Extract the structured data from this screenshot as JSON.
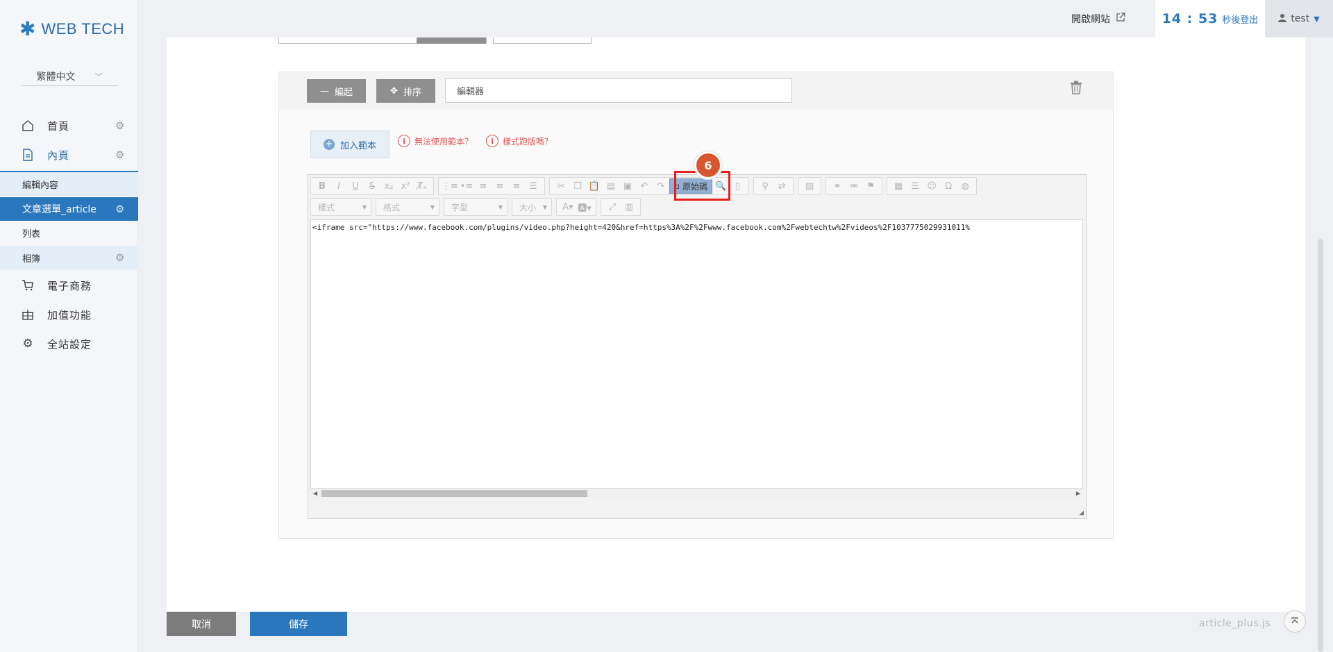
{
  "brand": {
    "logo_text": "WEB TECH"
  },
  "sidebar": {
    "language": "繁體中文",
    "items": [
      {
        "label": "首頁"
      },
      {
        "label": "內頁"
      },
      {
        "label": "電子商務"
      },
      {
        "label": "加值功能"
      },
      {
        "label": "全站設定"
      }
    ],
    "subitems": [
      {
        "label": "編輯內容"
      },
      {
        "label": "文章選單_article"
      },
      {
        "label": "列表"
      },
      {
        "label": "相簿"
      }
    ]
  },
  "topbar": {
    "open_site": "開啟網站",
    "countdown": "14 : 53",
    "countdown_suffix": "秒後登出",
    "user": "test"
  },
  "block": {
    "collapse_label": "編起",
    "sort_label": "排序",
    "title_value": "編輯器",
    "add_template": "加入範本",
    "warn1": "無法使用範本？",
    "warn2": "樣式跑版嗎？"
  },
  "editor": {
    "combos": [
      "樣式",
      "格式",
      "字型",
      "大小"
    ],
    "source_label": "原始碼",
    "code": "<iframe src=\"https://www.facebook.com/plugins/video.php?height=420&href=https%3A%2F%2Fwww.facebook.com%2Fwebtechtw%2Fvideos%2F1037775029931011%"
  },
  "annotation": {
    "step": "6"
  },
  "footer": {
    "cancel": "取消",
    "save": "儲存",
    "script_name": "article_plus.js"
  }
}
